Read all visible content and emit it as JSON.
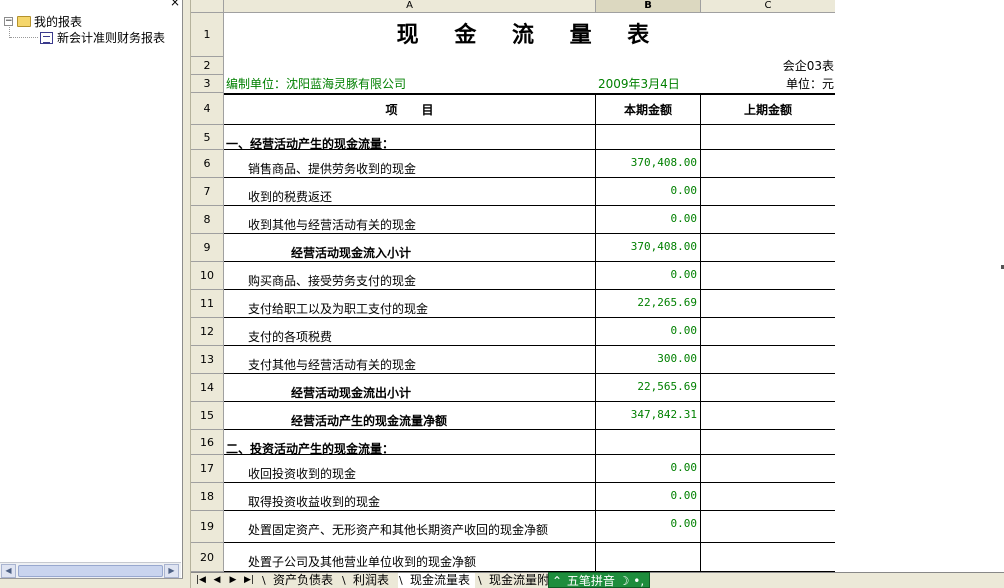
{
  "tree": {
    "close_glyph": "×",
    "root": {
      "expander": "−",
      "label": "我的报表"
    },
    "child": {
      "label": "新会计准则财务报表"
    }
  },
  "columns": [
    {
      "label": "",
      "key": "row"
    },
    {
      "label": "A",
      "key": "a"
    },
    {
      "label": "B",
      "key": "b"
    },
    {
      "label": "C",
      "key": "c"
    }
  ],
  "report": {
    "title": "现 金 流 量 表",
    "form_no": "会企03表",
    "unit_label": "编制单位：沈阳蓝海灵豚有限公司",
    "date": "2009年3月4日",
    "currency": "单位：元",
    "header_item": "项　　目",
    "header_current": "本期金额",
    "header_previous": "上期金额"
  },
  "row_numbers": [
    "1",
    "2",
    "3",
    "4",
    "5",
    "6",
    "7",
    "8",
    "9",
    "10",
    "11",
    "12",
    "13",
    "14",
    "15",
    "16",
    "17",
    "18",
    "19",
    "20"
  ],
  "items": [
    {
      "row": "5",
      "label": "一、经营活动产生的现金流量：",
      "kind": "sect",
      "current": ""
    },
    {
      "row": "6",
      "label": "销售商品、提供劳务收到的现金",
      "kind": "indent",
      "current": "370,408.00"
    },
    {
      "row": "7",
      "label": "收到的税费返还",
      "kind": "indent",
      "current": "0.00"
    },
    {
      "row": "8",
      "label": "收到其他与经营活动有关的现金",
      "kind": "indent",
      "current": "0.00"
    },
    {
      "row": "9",
      "label": "经营活动现金流入小计",
      "kind": "subtotal",
      "current": "370,408.00"
    },
    {
      "row": "10",
      "label": "购买商品、接受劳务支付的现金",
      "kind": "indent",
      "current": "0.00"
    },
    {
      "row": "11",
      "label": "支付给职工以及为职工支付的现金",
      "kind": "indent",
      "current": "22,265.69"
    },
    {
      "row": "12",
      "label": "支付的各项税费",
      "kind": "indent",
      "current": "0.00"
    },
    {
      "row": "13",
      "label": "支付其他与经营活动有关的现金",
      "kind": "indent",
      "current": "300.00"
    },
    {
      "row": "14",
      "label": "经营活动现金流出小计",
      "kind": "subtotal",
      "current": "22,565.69"
    },
    {
      "row": "15",
      "label": "经营活动产生的现金流量净额",
      "kind": "subtotal",
      "current": "347,842.31"
    },
    {
      "row": "16",
      "label": "二、投资活动产生的现金流量：",
      "kind": "sect",
      "current": ""
    },
    {
      "row": "17",
      "label": "收回投资收到的现金",
      "kind": "indent",
      "current": "0.00"
    },
    {
      "row": "18",
      "label": "取得投资收益收到的现金",
      "kind": "indent",
      "current": "0.00"
    },
    {
      "row": "19",
      "label": "处置固定资产、无形资产和其他长期资产收回的现金净额",
      "kind": "indent",
      "current": "0.00"
    },
    {
      "row": "20",
      "label": "处置子公司及其他营业单位收到的现金净额",
      "kind": "indent",
      "current": ""
    }
  ],
  "sheet_tabs": [
    {
      "label": "资产负债表",
      "active": false
    },
    {
      "label": "利润表",
      "active": false
    },
    {
      "label": "现金流量表",
      "active": true
    },
    {
      "label": "现金流量附",
      "active": false
    }
  ],
  "nav_buttons": [
    "|◀",
    "◀",
    "▶",
    "▶|"
  ],
  "ime": {
    "label": "五笔拼音",
    "icon": "⌃",
    "extra": "☽ •,"
  },
  "colors": {
    "green_text": "#008000",
    "chrome": "#ece9d8",
    "ime": "#1e8d3c"
  }
}
